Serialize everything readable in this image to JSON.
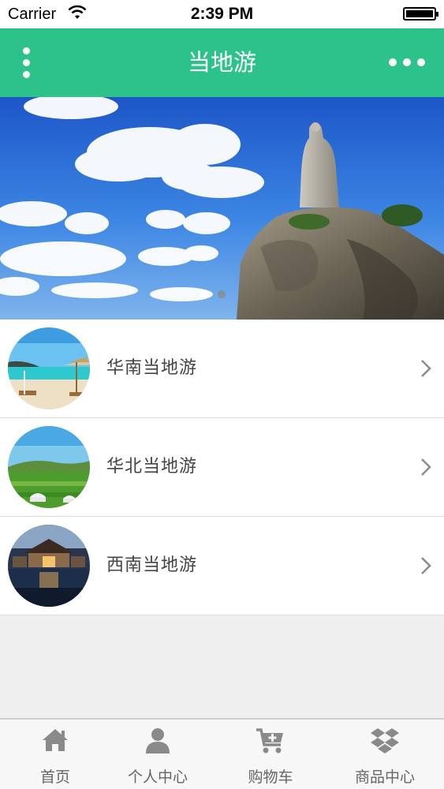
{
  "status_bar": {
    "carrier": "Carrier",
    "time": "2:39 PM"
  },
  "header": {
    "title": "当地游",
    "left_icon": "vertical-dots-menu-icon",
    "right_icon": "horizontal-dots-more-icon",
    "color": "#2cc28a"
  },
  "banner": {
    "slide_count": 2,
    "active_slide": 1
  },
  "list": {
    "items": [
      {
        "label": "华南当地游",
        "thumb": "beach-photo"
      },
      {
        "label": "华北当地游",
        "thumb": "grassland-photo"
      },
      {
        "label": "西南当地游",
        "thumb": "resort-photo"
      }
    ]
  },
  "tab_bar": {
    "tabs": [
      {
        "label": "首页",
        "icon": "home-icon"
      },
      {
        "label": "个人中心",
        "icon": "user-icon"
      },
      {
        "label": "购物车",
        "icon": "cart-icon"
      },
      {
        "label": "商品中心",
        "icon": "dropbox-icon"
      }
    ]
  }
}
